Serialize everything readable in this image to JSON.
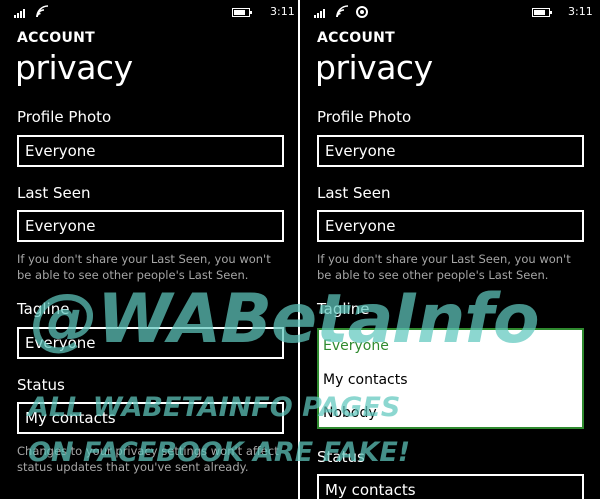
{
  "status_bar": {
    "time": "3:11",
    "icons": [
      "signal-icon",
      "wifi-icon",
      "record-icon",
      "battery-icon"
    ]
  },
  "screens": [
    {
      "app_title": "ACCOUNT",
      "page_title": "privacy",
      "profile_photo": {
        "label": "Profile Photo",
        "value": "Everyone"
      },
      "last_seen": {
        "label": "Last Seen",
        "value": "Everyone"
      },
      "last_seen_note": "If you don't share your Last Seen, you won't be able to see other people's Last Seen.",
      "tagline": {
        "label": "Tagline",
        "value": "Everyone"
      },
      "status": {
        "label": "Status",
        "value": "My contacts"
      },
      "status_note": "Changes to your privacy settings won't affect status updates that you've sent already."
    },
    {
      "app_title": "ACCOUNT",
      "page_title": "privacy",
      "profile_photo": {
        "label": "Profile Photo",
        "value": "Everyone"
      },
      "last_seen": {
        "label": "Last Seen",
        "value": "Everyone"
      },
      "last_seen_note": "If you don't share your Last Seen, you won't be able to see other people's Last Seen.",
      "tagline": {
        "label": "Tagline",
        "options": [
          "Everyone",
          "My contacts",
          "Nobody"
        ],
        "selected": "Everyone"
      },
      "status": {
        "label": "Status",
        "value": "My contacts"
      }
    }
  ],
  "watermark": {
    "handle": "@WABetaInfo",
    "line1": "ALL WABETAINFO PAGES",
    "line2": "ON FACEBOOK ARE FAKE!"
  },
  "colors": {
    "background": "#000000",
    "text": "#ffffff",
    "note_text": "#a6a6a6",
    "picker_border": "#2f8a2f",
    "picker_selected": "#2f8a2f",
    "watermark": "#60c8be"
  }
}
